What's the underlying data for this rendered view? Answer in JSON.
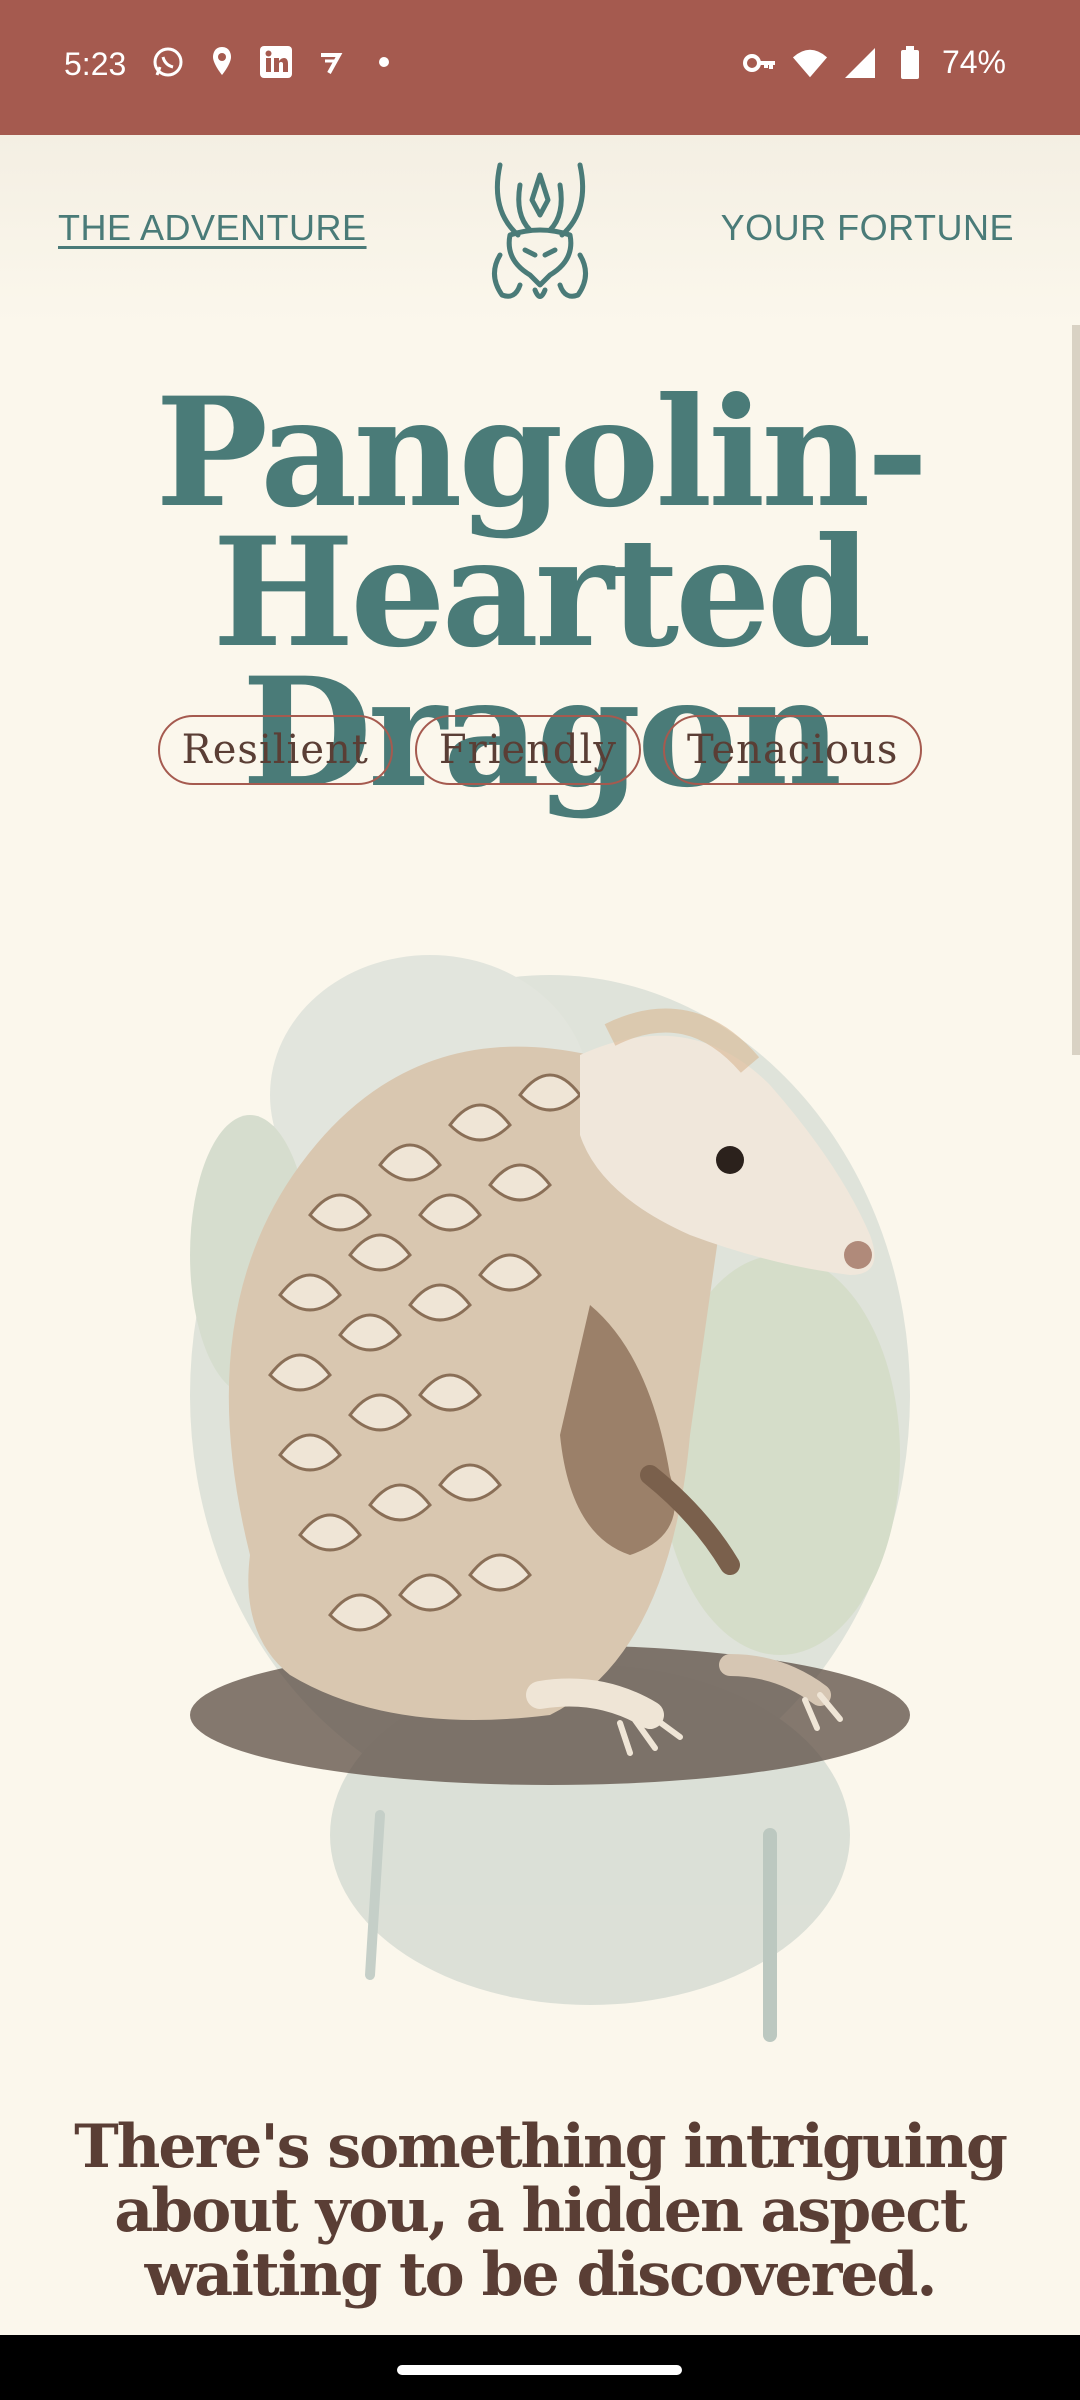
{
  "status_bar": {
    "time": "5:23",
    "left_icons": [
      "whatsapp-icon",
      "location-pin-icon",
      "linkedin-icon",
      "app-glyph-icon",
      "dot-icon"
    ],
    "right_icons": [
      "vpn-key-icon",
      "wifi-icon",
      "signal-icon",
      "battery-icon"
    ],
    "battery": "74%"
  },
  "header": {
    "left_link": "THE ADVENTURE",
    "right_link": "YOUR FORTUNE",
    "logo_icon": "dragon-head-icon"
  },
  "result": {
    "title_line1": "Pangolin-",
    "title_line2": "Hearted Dragon",
    "tags": [
      "Resilient",
      "Friendly",
      "Tenacious"
    ],
    "illustration": "pangolin-illustration",
    "description": "There's something intriguing about you, a hidden aspect waiting to be discovered."
  },
  "colors": {
    "status_bar": "#a55a4f",
    "teal": "#4a7b78",
    "brown": "#5a3e35",
    "page_bg": "#fbf7ec"
  }
}
